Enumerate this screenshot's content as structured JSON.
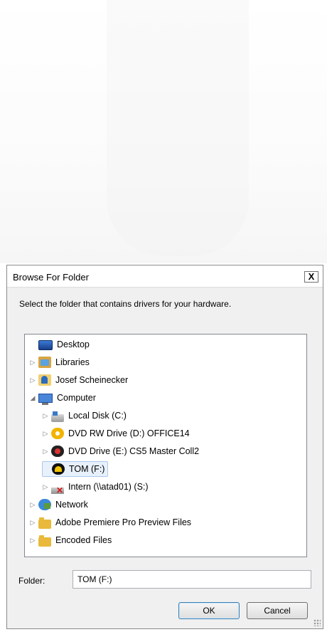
{
  "dialog": {
    "title": "Browse For Folder",
    "close_label": "X",
    "instruction": "Select the folder that contains drivers for your hardware.",
    "folder_label": "Folder:",
    "folder_value": "TOM (F:)",
    "ok_label": "OK",
    "cancel_label": "Cancel"
  },
  "tree": [
    {
      "label": "Desktop",
      "icon": "desktop-icon",
      "toggle": ""
    },
    {
      "label": "Libraries",
      "icon": "libraries-icon",
      "toggle": "▷"
    },
    {
      "label": "Josef Scheinecker",
      "icon": "user-folder-icon",
      "toggle": "▷"
    },
    {
      "label": "Computer",
      "icon": "computer-icon",
      "toggle": "◢"
    },
    {
      "label": "Local Disk (C:)",
      "icon": "local-disk-icon",
      "toggle": "▷"
    },
    {
      "label": "DVD RW Drive (D:) OFFICE14",
      "icon": "dvd-rw-icon",
      "toggle": "▷"
    },
    {
      "label": "DVD Drive (E:) CS5 Master Coll2",
      "icon": "dvd-drive-icon",
      "toggle": "▷"
    },
    {
      "label": "TOM (F:)",
      "icon": "removable-drive-icon",
      "toggle": "",
      "selected": true
    },
    {
      "label": "Intern (\\\\atad01) (S:)",
      "icon": "disconnected-network-drive-icon",
      "toggle": "▷"
    },
    {
      "label": "Network",
      "icon": "network-icon",
      "toggle": "▷"
    },
    {
      "label": "Adobe Premiere Pro Preview Files",
      "icon": "folder-icon",
      "toggle": "▷"
    },
    {
      "label": "Encoded Files",
      "icon": "folder-icon",
      "toggle": "▷"
    }
  ]
}
